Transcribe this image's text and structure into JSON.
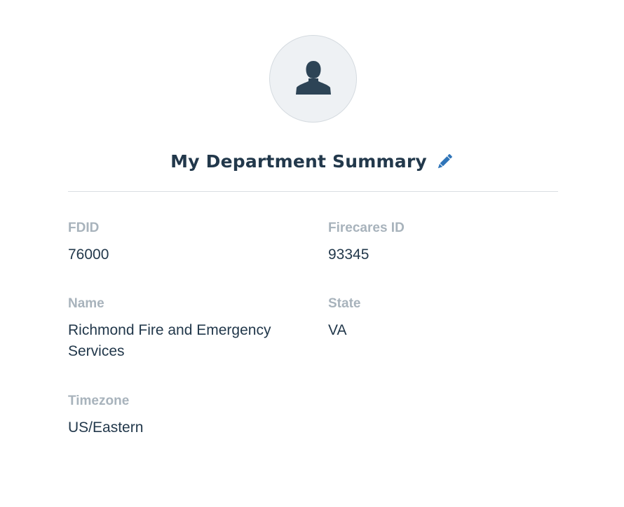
{
  "profile": {
    "avatar_icon": "user-silhouette-icon",
    "title": "My Department Summary",
    "edit_icon": "pencil-icon"
  },
  "colors": {
    "heading": "#22384b",
    "label": "#a8b3bc",
    "accent": "#2f74b8",
    "avatar_bg": "#eef1f4"
  },
  "fields": {
    "fdid": {
      "label": "FDID",
      "value": "76000"
    },
    "firecares_id": {
      "label": "Firecares ID",
      "value": "93345"
    },
    "name": {
      "label": "Name",
      "value": "Richmond Fire and Emergency Services"
    },
    "state": {
      "label": "State",
      "value": "VA"
    },
    "timezone": {
      "label": "Timezone",
      "value": "US/Eastern"
    }
  }
}
